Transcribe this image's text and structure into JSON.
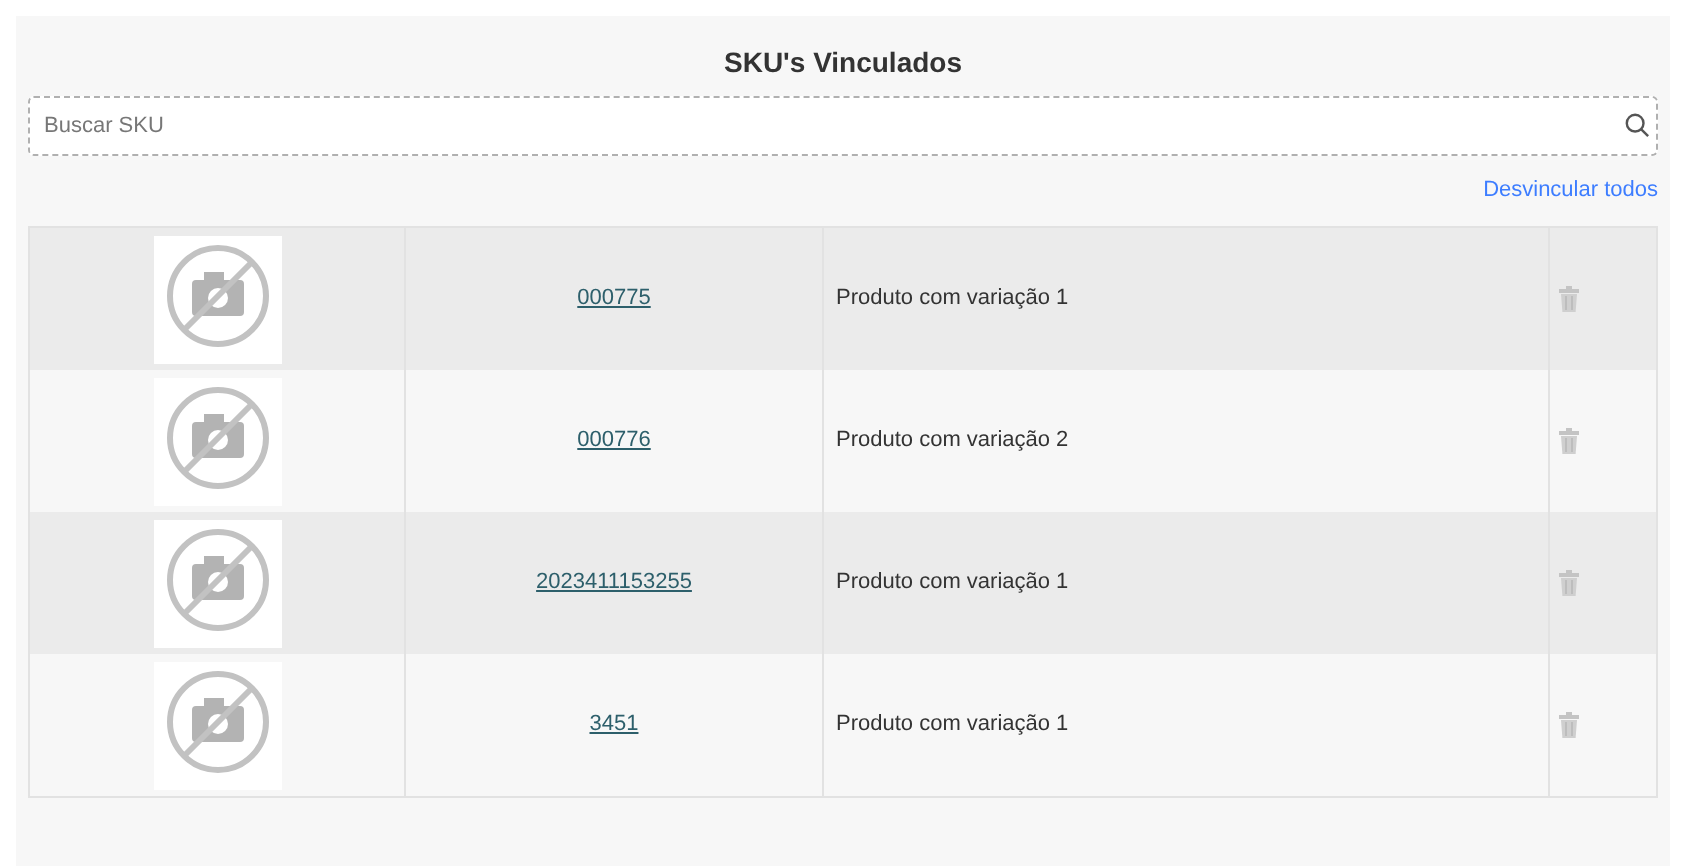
{
  "title": "SKU's Vinculados",
  "search": {
    "placeholder": "Buscar SKU"
  },
  "unlink_all": "Desvincular todos",
  "rows": [
    {
      "sku": "000775",
      "name": "Produto com variação 1"
    },
    {
      "sku": "000776",
      "name": "Produto com variação 2"
    },
    {
      "sku": "2023411153255",
      "name": "Produto com variação 1"
    },
    {
      "sku": "3451",
      "name": "Produto com variação 1"
    }
  ]
}
